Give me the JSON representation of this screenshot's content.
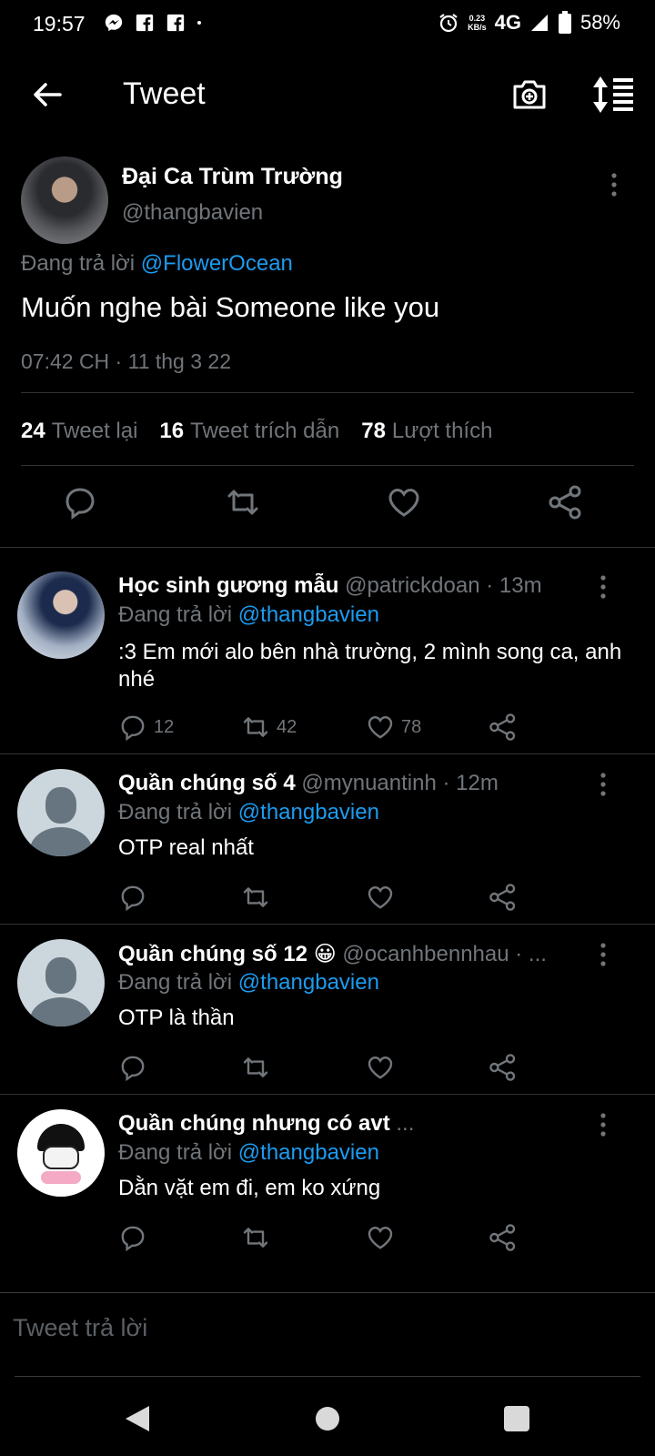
{
  "status_bar": {
    "time": "19:57",
    "net_speed_value": "0.23",
    "net_speed_unit": "KB/s",
    "network": "4G",
    "battery": "58%",
    "left_icons": [
      "messenger-icon",
      "facebook-icon",
      "facebook-icon",
      "dot-icon"
    ],
    "right_icons": [
      "alarm-icon",
      "signal-icon",
      "battery-icon"
    ]
  },
  "app_bar": {
    "title": "Tweet"
  },
  "main_tweet": {
    "author_name": "Đại Ca Trùm Trường",
    "author_handle": "@thangbavien",
    "reply_prefix": "Đang trả lời",
    "reply_to": "@FlowerOcean",
    "text": "Muốn nghe bài Someone like you",
    "timestamp": "07:42 CH · 11 thg 3 22",
    "stats": [
      {
        "count": "24",
        "label": "Tweet lại"
      },
      {
        "count": "16",
        "label": "Tweet trích dẫn"
      },
      {
        "count": "78",
        "label": "Lượt thích"
      }
    ]
  },
  "replies": [
    {
      "name": "Học sinh gương mẫu",
      "meta": "@patrickdoan · 13m",
      "reply_prefix": "Đang trả lời",
      "reply_to": "@thangbavien",
      "text": ":3 Em mới alo bên nhà trường, 2 mình song ca, anh nhé",
      "reply_count": "12",
      "retweet_count": "42",
      "like_count": "78"
    },
    {
      "name": "Quần chúng số 4",
      "meta": "@mynuantinh · 12m",
      "reply_prefix": "Đang trả lời",
      "reply_to": "@thangbavien",
      "text": "OTP real nhất",
      "reply_count": "",
      "retweet_count": "",
      "like_count": ""
    },
    {
      "name": "Quần chúng số 12 😀",
      "meta": "@ocanhbennhau · ...",
      "reply_prefix": "Đang trả lời",
      "reply_to": "@thangbavien",
      "text": "OTP là thần",
      "reply_count": "",
      "retweet_count": "",
      "like_count": ""
    },
    {
      "name": "Quần chúng nhưng có avt",
      "meta": "...",
      "reply_prefix": "Đang trả lời",
      "reply_to": "@thangbavien",
      "text": "Dằn vặt em đi, em ko xứng",
      "reply_count": "",
      "retweet_count": "",
      "like_count": ""
    }
  ],
  "compose": {
    "placeholder": "Tweet trả lời"
  },
  "colors": {
    "background": "#000000",
    "text": "#e7e9ea",
    "secondary": "#71767b",
    "accent": "#1d9bf0",
    "divider": "#2f3336"
  }
}
